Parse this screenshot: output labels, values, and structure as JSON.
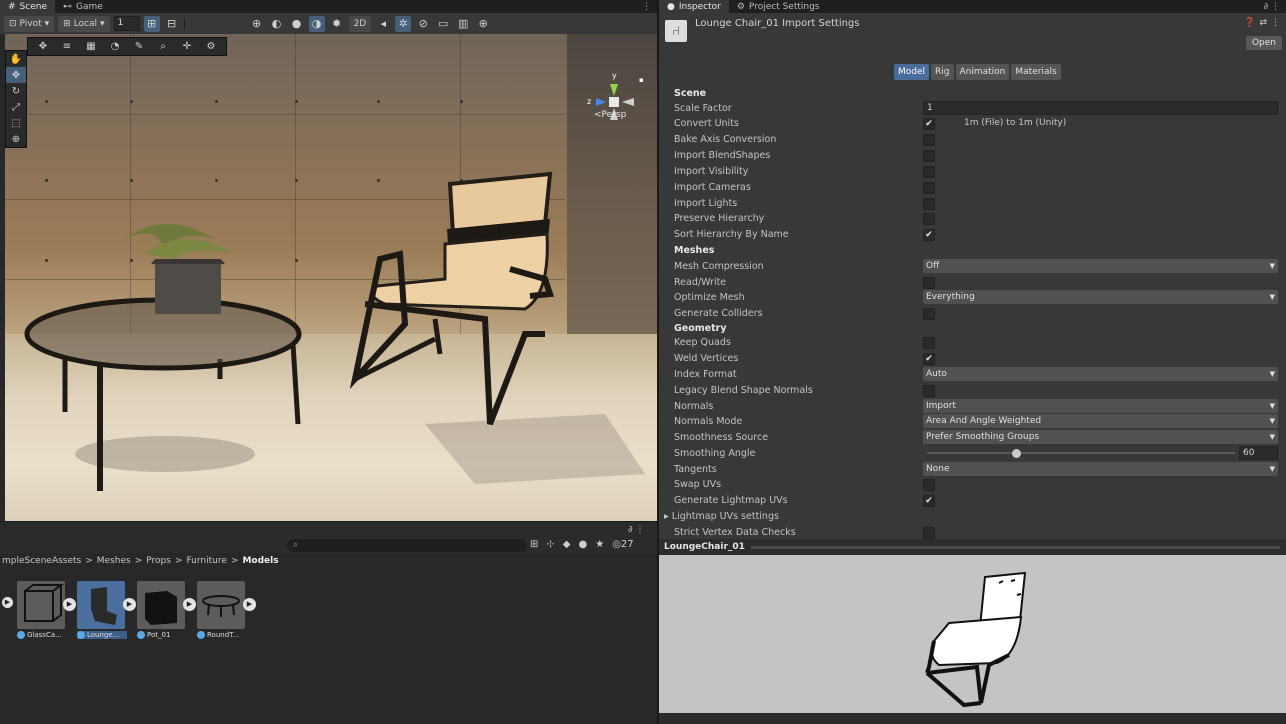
{
  "scene_tabs": [
    {
      "label": "Scene",
      "icon": "scene-icon"
    },
    {
      "label": "Game",
      "icon": "gamepad-icon"
    }
  ],
  "scene_toolbar": {
    "pivot_label": "Pivot",
    "local_label": "Local",
    "grid_value": "1",
    "mode_2d_label": "2D"
  },
  "viewport": {
    "camera_label": "<Persp",
    "gizmo_axes": {
      "y": "y",
      "z": "z"
    }
  },
  "project": {
    "breadcrumb": [
      "mpleSceneAssets",
      "Meshes",
      "Props",
      "Furniture",
      "Models"
    ],
    "visible_count": "27",
    "assets": [
      {
        "label": "GlassCa...",
        "selected": false
      },
      {
        "label": "Lounge...",
        "selected": true
      },
      {
        "label": "Pot_01",
        "selected": false
      },
      {
        "label": "RoundT...",
        "selected": false
      }
    ]
  },
  "inspector_tabs": [
    {
      "label": "Inspector",
      "icon": "info-icon"
    },
    {
      "label": "Project Settings",
      "icon": "gear-icon"
    }
  ],
  "inspector": {
    "title": "Lounge Chair_01 Import Settings",
    "open_label": "Open",
    "tabs": [
      "Model",
      "Rig",
      "Animation",
      "Materials"
    ],
    "active_tab": "Model",
    "scene_section": "Scene",
    "scale_factor_label": "Scale Factor",
    "scale_factor_value": "1",
    "convert_units_label": "Convert Units",
    "convert_units_note": "1m (File) to 1m (Unity)",
    "bake_axis_label": "Bake Axis Conversion",
    "import_blendshapes_label": "Import BlendShapes",
    "import_visibility_label": "Import Visibility",
    "import_cameras_label": "Import Cameras",
    "import_lights_label": "Import Lights",
    "preserve_hierarchy_label": "Preserve Hierarchy",
    "sort_hierarchy_label": "Sort Hierarchy By Name",
    "meshes_section": "Meshes",
    "mesh_compression_label": "Mesh Compression",
    "mesh_compression_value": "Off",
    "read_write_label": "Read/Write",
    "optimize_mesh_label": "Optimize Mesh",
    "optimize_mesh_value": "Everything",
    "generate_colliders_label": "Generate Colliders",
    "geometry_section": "Geometry",
    "keep_quads_label": "Keep Quads",
    "weld_vertices_label": "Weld Vertices",
    "index_format_label": "Index Format",
    "index_format_value": "Auto",
    "legacy_blend_label": "Legacy Blend Shape Normals",
    "normals_label": "Normals",
    "normals_value": "Import",
    "normals_mode_label": "Normals Mode",
    "normals_mode_value": "Area And Angle Weighted",
    "smoothness_source_label": "Smoothness Source",
    "smoothness_source_value": "Prefer Smoothing Groups",
    "smoothing_angle_label": "Smoothing Angle",
    "smoothing_angle_value": "60",
    "smoothing_angle_fraction": 0.333,
    "tangents_label": "Tangents",
    "tangents_value": "None",
    "swap_uvs_label": "Swap UVs",
    "generate_lightmap_label": "Generate Lightmap UVs",
    "lightmap_settings_label": "Lightmap UVs settings",
    "strict_vertex_label": "Strict Vertex Data Checks",
    "checkmark": "✔",
    "checks": {
      "convert_units": true,
      "bake_axis": false,
      "import_blendshapes": false,
      "import_visibility": false,
      "import_cameras": false,
      "import_lights": false,
      "preserve_hierarchy": false,
      "sort_hierarchy": true,
      "read_write": false,
      "generate_colliders": false,
      "keep_quads": false,
      "weld_vertices": true,
      "legacy_blend": false,
      "swap_uvs": false,
      "generate_lightmap": true,
      "strict_vertex": false
    }
  },
  "preview": {
    "name": "LoungeChair_01"
  },
  "colors": {
    "accent": "#4a6c9b",
    "panel": "#383838",
    "preview_bg": "#c4c4c4"
  }
}
